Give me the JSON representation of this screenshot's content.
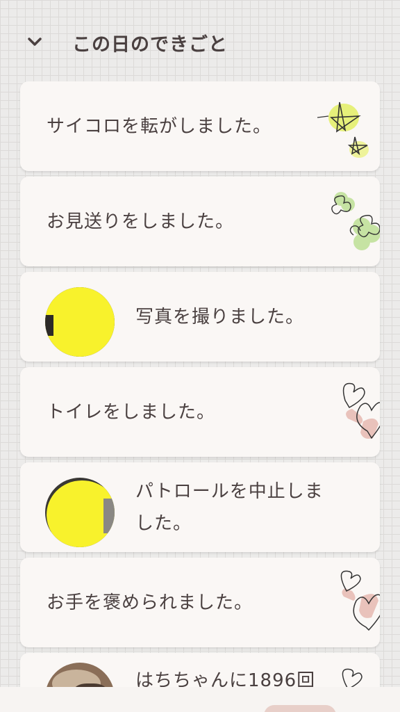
{
  "header": {
    "title": "この日のできごと",
    "toggle_icon": "chevron-down-icon"
  },
  "events": [
    {
      "text": "サイコロを転がしました。",
      "decoration": "star-doodle-icon"
    },
    {
      "text": "お見送りをしました。",
      "decoration": "clover-doodle-icon"
    },
    {
      "text": "写真を撮りました。",
      "has_photo": true
    },
    {
      "text": "トイレをしました。",
      "decoration": "heart-doodle-icon"
    },
    {
      "text_line1": "パトロールを中止しま",
      "text_line2": "した。",
      "has_photo": true
    },
    {
      "text": "お手を褒められました。",
      "decoration": "heart-doodle-icon"
    },
    {
      "text": "はちちゃんに1896回",
      "has_photo": true,
      "decoration": "heart-doodle-icon"
    }
  ],
  "colors": {
    "text": "#4a4040",
    "card": "#faf7f5",
    "background": "#ecebea"
  }
}
